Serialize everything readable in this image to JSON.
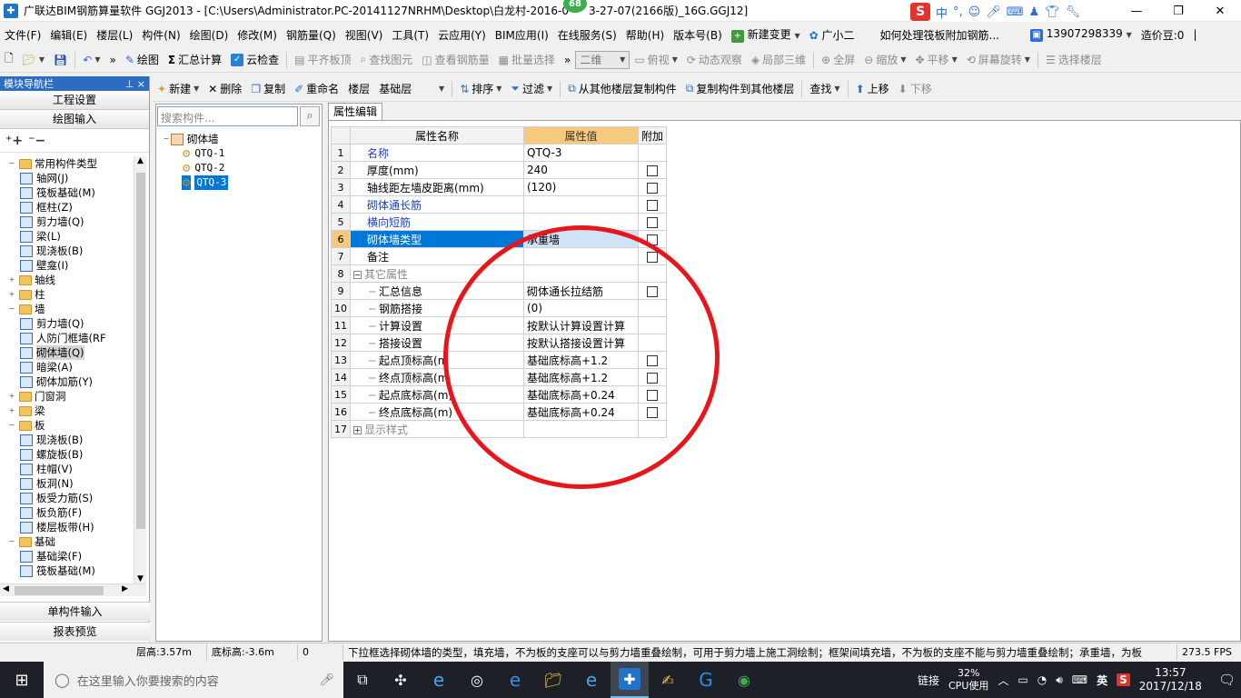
{
  "titlebar": {
    "app_icon": "glodon-app-icon",
    "title": "广联达BIM钢筋算量软件 GGJ2013 - [C:\\Users\\Administrator.PC-20141127NRHM\\Desktop\\白龙村-2016-0",
    "title_tail": "3-27-07(2166版)_16G.GGJ12]",
    "notification_badge": "68",
    "controls": {
      "minimize": "—",
      "restore": "❐",
      "close": "✕"
    },
    "ime": {
      "logo": "S",
      "lang": "中"
    }
  },
  "menubar": {
    "items": [
      "文件(F)",
      "编辑(E)",
      "楼层(L)",
      "构件(N)",
      "绘图(D)",
      "修改(M)",
      "钢筋量(Q)",
      "视图(V)",
      "工具(T)",
      "云应用(Y)",
      "BIM应用(I)",
      "在线服务(S)",
      "帮助(H)",
      "版本号(B)"
    ],
    "new_change": "新建变更",
    "guang_xiao_er": "广小二",
    "tip": "如何处理筏板附加钢筋...",
    "phone": "13907298339",
    "credits": "造价豆:0"
  },
  "toolbar1": {
    "draw": "绘图",
    "sum": "汇总计算",
    "cloud_check": "云检查",
    "align_slab": "平齐板顶",
    "find_element": "查找图元",
    "view_rebar": "查看钢筋量",
    "batch_select": "批量选择",
    "view_mode": "二维",
    "top_view": "俯视",
    "dynamic": "动态观察",
    "local_3d": "局部三维",
    "fullscreen": "全屏",
    "zoom": "缩放",
    "pan": "平移",
    "rotate": "屏幕旋转",
    "select_floor": "选择楼层"
  },
  "toolbar2": {
    "new": "新建",
    "delete": "删除",
    "copy": "复制",
    "rename": "重命名",
    "floor_label": "楼层",
    "floor_value": "基础层",
    "sort": "排序",
    "filter": "过滤",
    "copy_from": "从其他楼层复制构件",
    "copy_to": "复制构件到其他楼层",
    "find": "查找",
    "move_up": "上移",
    "move_down": "下移"
  },
  "nav": {
    "header": "模块导航栏",
    "pin": "⊥",
    "close": "×",
    "project_settings": "工程设置",
    "drawing_input": "绘图输入",
    "single_input": "单构件输入",
    "report_preview": "报表预览",
    "tree": [
      {
        "level": 0,
        "type": "folder",
        "exp": "−",
        "label": "常用构件类型"
      },
      {
        "level": 1,
        "type": "item",
        "label": "轴网(J)"
      },
      {
        "level": 1,
        "type": "item",
        "label": "筏板基础(M)"
      },
      {
        "level": 1,
        "type": "item",
        "label": "框柱(Z)"
      },
      {
        "level": 1,
        "type": "item",
        "label": "剪力墙(Q)"
      },
      {
        "level": 1,
        "type": "item",
        "label": "梁(L)"
      },
      {
        "level": 1,
        "type": "item",
        "label": "现浇板(B)"
      },
      {
        "level": 1,
        "type": "item",
        "label": "壁龛(I)"
      },
      {
        "level": 0,
        "type": "folder",
        "exp": "+",
        "label": "轴线"
      },
      {
        "level": 0,
        "type": "folder",
        "exp": "+",
        "label": "柱"
      },
      {
        "level": 0,
        "type": "folder",
        "exp": "−",
        "label": "墙"
      },
      {
        "level": 1,
        "type": "item",
        "label": "剪力墙(Q)"
      },
      {
        "level": 1,
        "type": "item",
        "label": "人防门框墙(RF"
      },
      {
        "level": 1,
        "type": "item",
        "label": "砌体墙(Q)",
        "selected": true
      },
      {
        "level": 1,
        "type": "item",
        "label": "暗梁(A)"
      },
      {
        "level": 1,
        "type": "item",
        "label": "砌体加筋(Y)"
      },
      {
        "level": 0,
        "type": "folder",
        "exp": "+",
        "label": "门窗洞"
      },
      {
        "level": 0,
        "type": "folder",
        "exp": "+",
        "label": "梁"
      },
      {
        "level": 0,
        "type": "folder",
        "exp": "−",
        "label": "板"
      },
      {
        "level": 1,
        "type": "item",
        "label": "现浇板(B)"
      },
      {
        "level": 1,
        "type": "item",
        "label": "螺旋板(B)"
      },
      {
        "level": 1,
        "type": "item",
        "label": "柱帽(V)"
      },
      {
        "level": 1,
        "type": "item",
        "label": "板洞(N)"
      },
      {
        "level": 1,
        "type": "item",
        "label": "板受力筋(S)"
      },
      {
        "level": 1,
        "type": "item",
        "label": "板负筋(F)"
      },
      {
        "level": 1,
        "type": "item",
        "label": "楼层板带(H)"
      },
      {
        "level": 0,
        "type": "folder",
        "exp": "−",
        "label": "基础"
      },
      {
        "level": 1,
        "type": "item",
        "label": "基础梁(F)"
      },
      {
        "level": 1,
        "type": "item",
        "label": "筏板基础(M)"
      }
    ]
  },
  "components": {
    "search_placeholder": "搜索构件...",
    "root": "砌体墙",
    "items": [
      "QTQ-1",
      "QTQ-2",
      "QTQ-3"
    ],
    "selected_index": 2
  },
  "props": {
    "tab": "属性编辑",
    "headers": {
      "name": "属性名称",
      "value": "属性值",
      "add": "附加"
    },
    "rows": [
      {
        "n": "1",
        "name": "名称",
        "value": "QTQ-3",
        "style": "blue",
        "cb": false,
        "indent": 0
      },
      {
        "n": "2",
        "name": "厚度(mm)",
        "value": "240",
        "style": "",
        "cb": true,
        "indent": 0
      },
      {
        "n": "3",
        "name": "轴线距左墙皮距离(mm)",
        "value": "(120)",
        "style": "",
        "cb": true,
        "indent": 0
      },
      {
        "n": "4",
        "name": "砌体通长筋",
        "value": "",
        "style": "blue",
        "cb": true,
        "indent": 0
      },
      {
        "n": "5",
        "name": "横向短筋",
        "value": "",
        "style": "blue",
        "cb": true,
        "indent": 0
      },
      {
        "n": "6",
        "name": "砌体墙类型",
        "value": "承重墙",
        "style": "",
        "cb": true,
        "indent": 0,
        "selected": true
      },
      {
        "n": "7",
        "name": "备注",
        "value": "",
        "style": "",
        "cb": true,
        "indent": 0
      },
      {
        "n": "8",
        "name": "其它属性",
        "value": "",
        "style": "gray",
        "cb": false,
        "indent": 0,
        "group": "−"
      },
      {
        "n": "9",
        "name": "汇总信息",
        "value": "砌体通长拉结筋",
        "style": "",
        "cb": true,
        "indent": 1
      },
      {
        "n": "10",
        "name": "钢筋搭接",
        "value": "(0)",
        "style": "",
        "cb": false,
        "indent": 1
      },
      {
        "n": "11",
        "name": "计算设置",
        "value": "按默认计算设置计算",
        "style": "",
        "cb": false,
        "indent": 1
      },
      {
        "n": "12",
        "name": "搭接设置",
        "value": "按默认搭接设置计算",
        "style": "",
        "cb": false,
        "indent": 1
      },
      {
        "n": "13",
        "name": "起点顶标高(m",
        "value": "基础底标高+1.2",
        "style": "",
        "cb": true,
        "indent": 1
      },
      {
        "n": "14",
        "name": "终点顶标高(m",
        "value": "基础底标高+1.2",
        "style": "",
        "cb": true,
        "indent": 1
      },
      {
        "n": "15",
        "name": "起点底标高(m)",
        "value": "基础底标高+0.24",
        "style": "",
        "cb": true,
        "indent": 1
      },
      {
        "n": "16",
        "name": "终点底标高(m)",
        "value": "基础底标高+0.24",
        "style": "",
        "cb": true,
        "indent": 1
      },
      {
        "n": "17",
        "name": "显示样式",
        "value": "",
        "style": "gray",
        "cb": false,
        "indent": 0,
        "group": "+"
      }
    ]
  },
  "status": {
    "floor_height": "层高:3.57m",
    "bottom_elev": "底标高:-3.6m",
    "zero": "0",
    "hint": "下拉框选择砌体墙的类型，填充墙，不为板的支座可以与剪力墙重叠绘制，可用于剪力墙上施工洞绘制；框架间填充墙，不为板的支座不能与剪力墙重叠绘制；承重墙，为板",
    "fps": "273.5 FPS"
  },
  "taskbar": {
    "search_placeholder": "在这里输入你要搜索的内容",
    "link": "链接",
    "cpu_percent": "32%",
    "cpu_label": "CPU使用",
    "lang": "英",
    "time": "13:57",
    "date": "2017/12/18"
  },
  "colors": {
    "accent": "#0078d7",
    "annotation": "#e8151b",
    "header_orange": "#f7c97c",
    "link_blue": "#1c3fc8"
  }
}
